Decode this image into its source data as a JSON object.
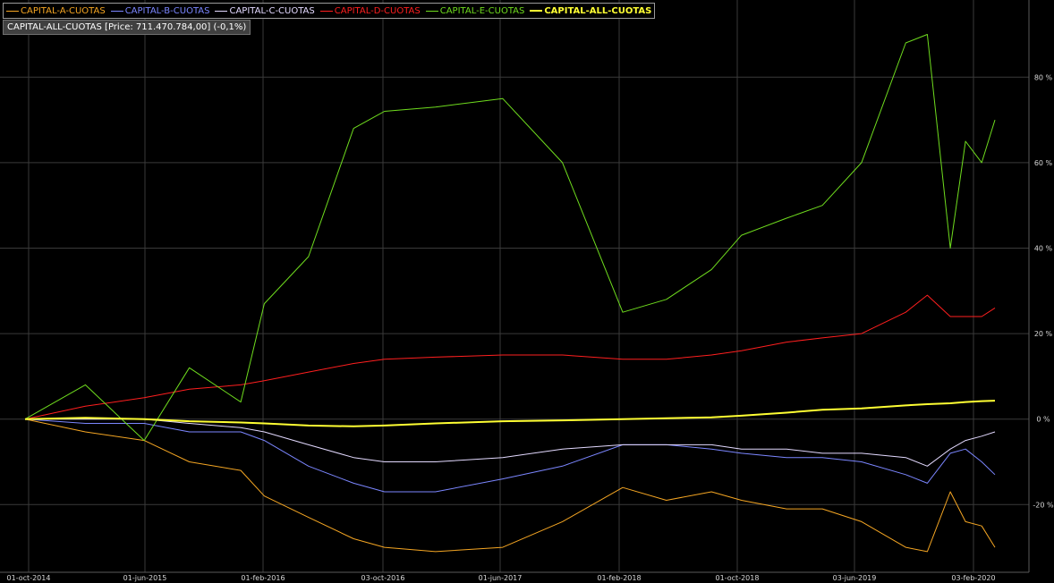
{
  "legend": {
    "items": [
      {
        "label": "CAPITAL-A-CUOTAS",
        "color": "#f5a623"
      },
      {
        "label": "CAPITAL-B-CUOTAS",
        "color": "#7b86ff"
      },
      {
        "label": "CAPITAL-C-CUOTAS",
        "color": "#e3d9ff"
      },
      {
        "label": "CAPITAL-D-CUOTAS",
        "color": "#ff1f1f"
      },
      {
        "label": "CAPITAL-E-CUOTAS",
        "color": "#6fdc1e"
      },
      {
        "label": "CAPITAL-ALL-CUOTAS",
        "color": "#ffff33"
      }
    ]
  },
  "info_box": "CAPITAL-ALL-CUOTAS [Price: 711.470.784,00] (-0,1%)",
  "chart_data": {
    "type": "line",
    "x_ticks": [
      "01-oct-2014",
      "01-jun-2015",
      "01-feb-2016",
      "03-oct-2016",
      "01-jun-2017",
      "01-feb-2018",
      "01-oct-2018",
      "03-jun-2019",
      "03-feb-2020"
    ],
    "y_ticks": [
      "80 %",
      "60 %",
      "40 %",
      "20 %",
      "0 %",
      "-20 %"
    ],
    "ylim": [
      -35,
      97
    ],
    "y_axis_position": "right",
    "grid": true,
    "legend_position": "top-left",
    "x": [
      "2014-10-01",
      "2015-02-01",
      "2015-06-01",
      "2015-09-01",
      "2015-12-15",
      "2016-02-01",
      "2016-05-01",
      "2016-08-01",
      "2016-10-03",
      "2017-01-15",
      "2017-06-01",
      "2017-10-01",
      "2018-02-01",
      "2018-05-01",
      "2018-08-01",
      "2018-10-01",
      "2019-01-01",
      "2019-03-15",
      "2019-06-03",
      "2019-09-01",
      "2019-10-15",
      "2019-12-01",
      "2020-01-01",
      "2020-02-03",
      "2020-03-01"
    ],
    "series": [
      {
        "name": "CAPITAL-A-CUOTAS",
        "color": "#f5a623",
        "width": 1,
        "values": [
          0,
          -3,
          -5,
          -10,
          -12,
          -18,
          -23,
          -28,
          -30,
          -31,
          -30,
          -24,
          -16,
          -19,
          -17,
          -19,
          -21,
          -21,
          -24,
          -30,
          -31,
          -17,
          -24,
          -25,
          -30
        ]
      },
      {
        "name": "CAPITAL-B-CUOTAS",
        "color": "#7b86ff",
        "width": 1,
        "values": [
          0,
          -1,
          -1,
          -3,
          -3,
          -5,
          -11,
          -15,
          -17,
          -17,
          -14,
          -11,
          -6,
          -6,
          -7,
          -8,
          -9,
          -9,
          -10,
          -13,
          -15,
          -8,
          -7,
          -10,
          -13
        ]
      },
      {
        "name": "CAPITAL-C-CUOTAS",
        "color": "#e3d9ff",
        "width": 1,
        "values": [
          0,
          0,
          0,
          -1,
          -2,
          -3,
          -6,
          -9,
          -10,
          -10,
          -9,
          -7,
          -6,
          -6,
          -6,
          -7,
          -7,
          -8,
          -8,
          -9,
          -11,
          -7,
          -5,
          -4,
          -3
        ]
      },
      {
        "name": "CAPITAL-D-CUOTAS",
        "color": "#ff1f1f",
        "width": 1,
        "values": [
          0,
          3,
          5,
          7,
          8,
          9,
          11,
          13,
          14,
          14.5,
          15,
          15,
          14,
          14,
          15,
          16,
          18,
          19,
          20,
          25,
          29,
          24,
          24,
          24,
          26
        ]
      },
      {
        "name": "CAPITAL-E-CUOTAS",
        "color": "#6fdc1e",
        "width": 1,
        "values": [
          0,
          8,
          -5,
          12,
          4,
          27,
          38,
          68,
          72,
          73,
          75,
          60,
          25,
          28,
          35,
          43,
          47,
          50,
          60,
          88,
          90,
          40,
          65,
          60,
          70
        ]
      },
      {
        "name": "CAPITAL-ALL-CUOTAS",
        "color": "#ffff33",
        "width": 2,
        "values": [
          0,
          0.3,
          0,
          -0.5,
          -0.8,
          -1,
          -1.5,
          -1.7,
          -1.5,
          -1,
          -0.5,
          -0.3,
          0,
          0.2,
          0.4,
          0.8,
          1.5,
          2.2,
          2.5,
          3.2,
          3.5,
          3.7,
          4,
          4.2,
          4.3
        ]
      }
    ]
  }
}
